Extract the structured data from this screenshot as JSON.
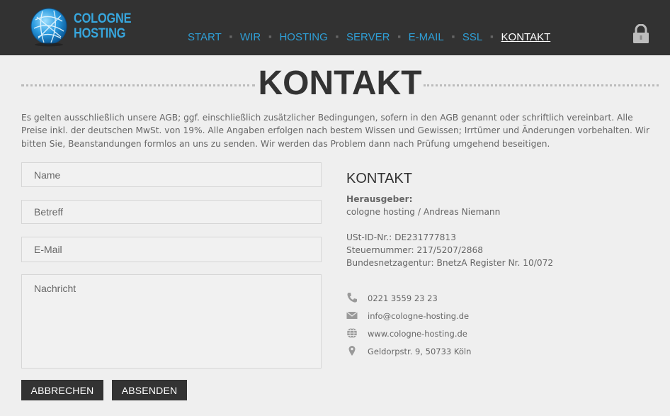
{
  "brand": {
    "line1": "COLOGNE",
    "line2": "HOSTING"
  },
  "nav": {
    "items": [
      {
        "label": "START"
      },
      {
        "label": "WIR"
      },
      {
        "label": "HOSTING"
      },
      {
        "label": "SERVER"
      },
      {
        "label": "E-MAIL"
      },
      {
        "label": "SSL"
      },
      {
        "label": "KONTAKT",
        "active": true
      }
    ]
  },
  "page": {
    "title": "KONTAKT",
    "intro": "Es gelten ausschließlich unsere AGB; ggf. einschließlich zusätzlicher Bedingungen, sofern in den AGB genannt oder schriftlich vereinbart. Alle Preise inkl. der deutschen MwSt. von 19%. Alle Angaben erfolgen nach bestem Wissen und Gewissen; Irrtümer und Änderungen vorbehalten. Wir bitten Sie, Beanstandungen formlos an uns zu senden. Wir werden das Problem dann nach Prüfung umgehend beseitigen."
  },
  "form": {
    "name_placeholder": "Name",
    "subject_placeholder": "Betreff",
    "email_placeholder": "E-Mail",
    "message_placeholder": "Nachricht",
    "cancel_label": "ABBRECHEN",
    "submit_label": "ABSENDEN"
  },
  "contact": {
    "heading": "KONTAKT",
    "publisher_label": "Herausgeber:",
    "publisher": "cologne hosting / Andreas Niemann",
    "vat_id": "USt-ID-Nr.: DE231777813",
    "tax_number": "Steuernummer: 217/5207/2868",
    "agency": "Bundesnetzagentur: BnetzA Register Nr. 10/072",
    "phone": "0221 3559 23 23",
    "email": "info@cologne-hosting.de",
    "website": "www.cologne-hosting.de",
    "address": "Geldorpstr. 9, 50733 Köln"
  },
  "colors": {
    "header_bg": "#323232",
    "accent": "#2f9fd6",
    "button_bg": "#333333"
  }
}
